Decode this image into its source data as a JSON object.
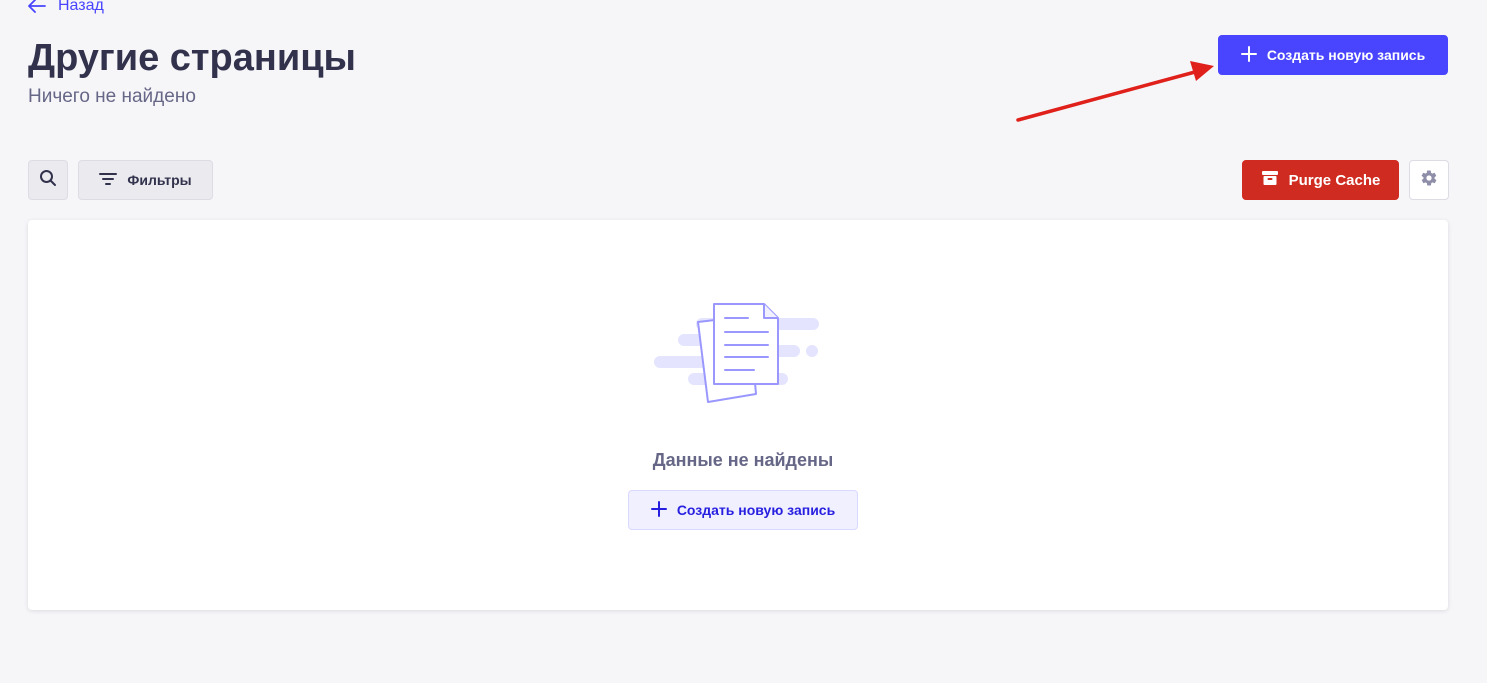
{
  "header": {
    "back_label": "Назад",
    "title": "Другие страницы",
    "subtitle": "Ничего не найдено",
    "create_label": "Создать новую запись"
  },
  "toolbar": {
    "filters_label": "Фильтры",
    "purge_label": "Purge Cache"
  },
  "empty_state": {
    "message": "Данные не найдены",
    "create_label": "Создать новую запись"
  },
  "icons": {
    "back": "arrow-left-icon",
    "create": "plus-icon",
    "search": "search-icon",
    "filter": "filter-icon",
    "purge": "archive-icon",
    "settings": "gear-icon",
    "empty": "documents-illustration"
  },
  "colors": {
    "primary": "#4945ff",
    "danger": "#d02b20",
    "annotation": "#e0211b",
    "background": "#f6f6f9"
  }
}
